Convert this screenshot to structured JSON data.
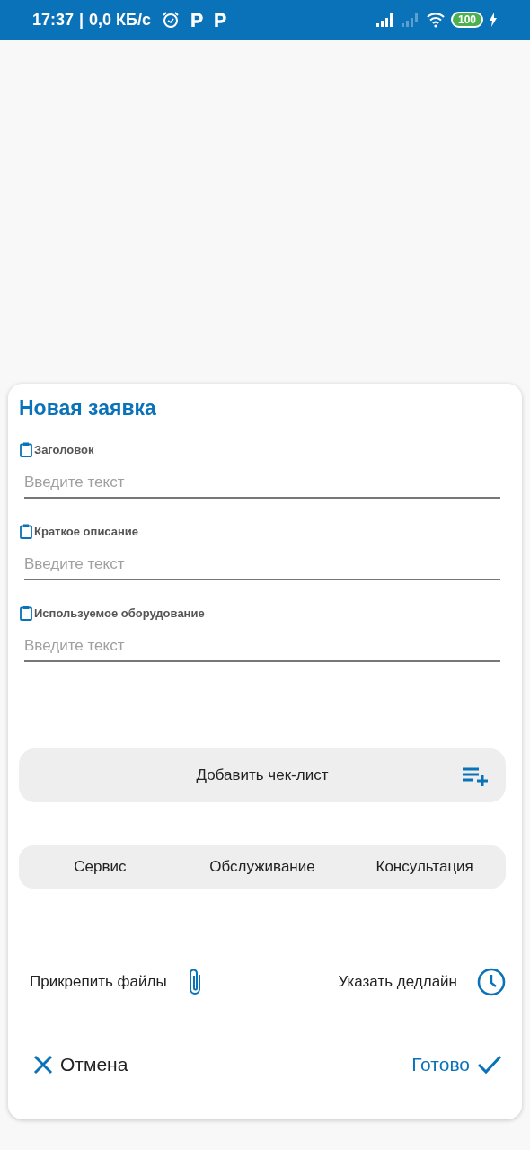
{
  "status_bar": {
    "time": "17:37",
    "separator": "|",
    "speed": "0,0 КБ/с",
    "battery": "100"
  },
  "dialog": {
    "title": "Новая заявка",
    "fields": [
      {
        "label": "Заголовок",
        "placeholder": "Введите текст"
      },
      {
        "label": "Краткое описание",
        "placeholder": "Введите текст"
      },
      {
        "label": "Используемое оборудование",
        "placeholder": "Введите текст"
      }
    ],
    "checklist_button": "Добавить чек-лист",
    "categories": [
      {
        "label": "Сервис",
        "selected": false
      },
      {
        "label": "Обслуживание",
        "selected": false
      },
      {
        "label": "Консультация",
        "selected": false
      }
    ],
    "attach_button": "Прикрепить файлы",
    "deadline_button": "Указать дедлайн",
    "cancel_button": "Отмена",
    "done_button": "Готово"
  }
}
